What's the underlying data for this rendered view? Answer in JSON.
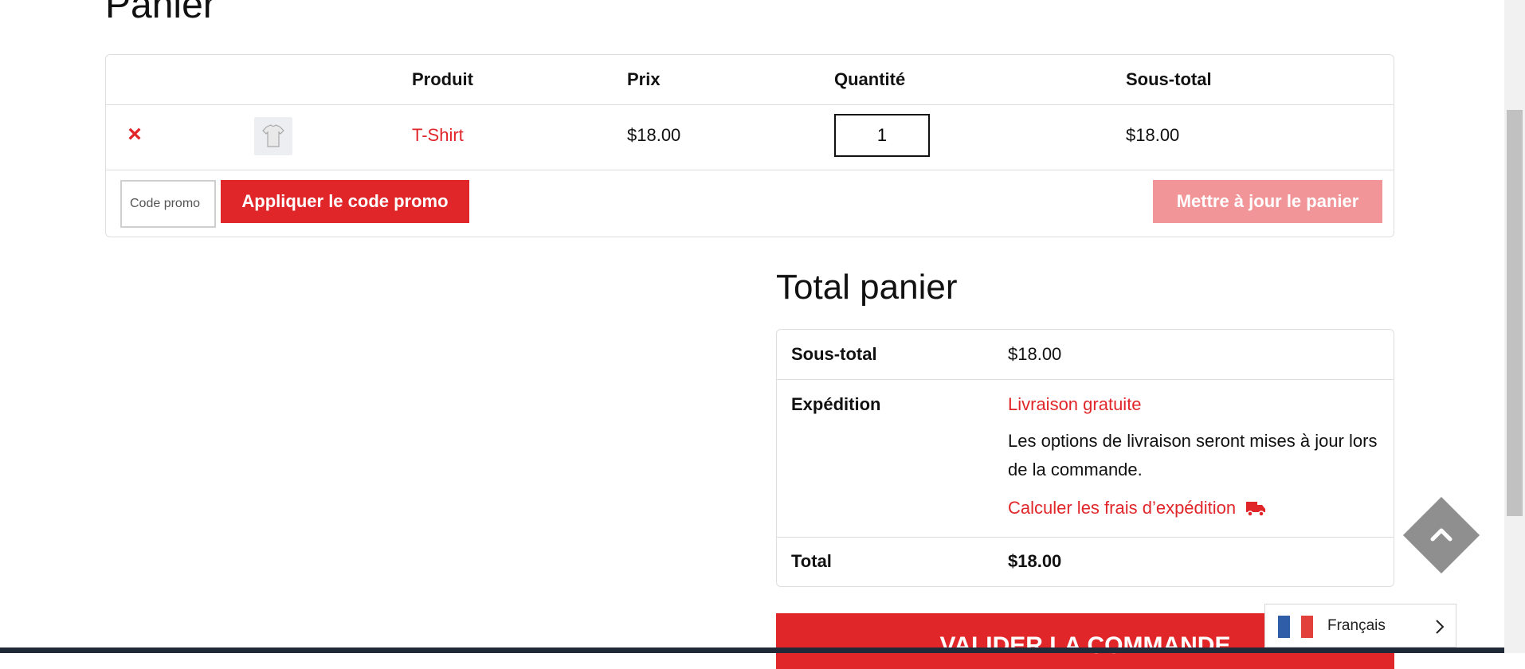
{
  "page": {
    "title": "Panier"
  },
  "cart": {
    "headers": {
      "product": "Produit",
      "price": "Prix",
      "quantity": "Quantité",
      "subtotal": "Sous-total"
    },
    "items": [
      {
        "name": "T-Shirt",
        "price": "$18.00",
        "quantity": "1",
        "subtotal": "$18.00"
      }
    ],
    "coupon_placeholder": "Code promo",
    "apply_label": "Appliquer le code promo",
    "update_label": "Mettre à jour le panier"
  },
  "totals": {
    "title": "Total panier",
    "subtotal_label": "Sous-total",
    "subtotal_value": "$18.00",
    "shipping_label": "Expédition",
    "shipping_method": "Livraison gratuite",
    "shipping_note": "Les options de livraison seront mises à jour lors de la commande.",
    "calc_shipping": "Calculer les frais d’expédition",
    "total_label": "Total",
    "total_value": "$18.00"
  },
  "checkout_label": "VALIDER LA COMMANDE",
  "language": {
    "label": "Français"
  },
  "colors": {
    "accent": "#e1262a",
    "accent_disabled": "#f19598",
    "scroll_top": "#8f8f8f"
  },
  "icons": [
    "remove-icon",
    "tshirt-thumbnail",
    "truck-icon",
    "chevron-up-icon",
    "france-flag-icon",
    "chevron-right-icon"
  ]
}
